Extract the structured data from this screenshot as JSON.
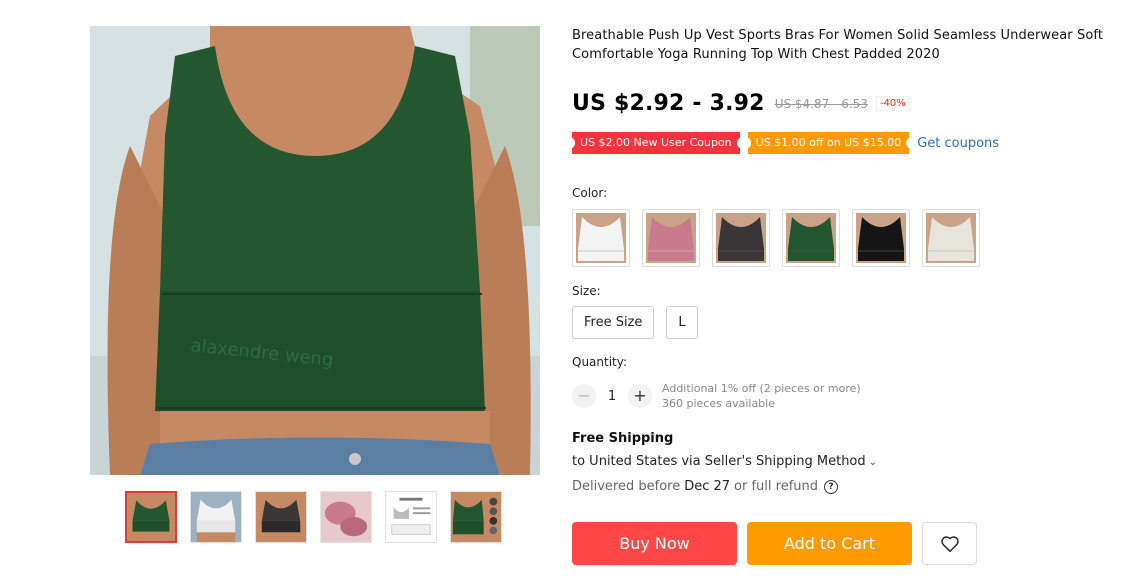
{
  "product": {
    "title": "Breathable Push Up Vest Sports Bras For Women Solid Seamless Underwear Soft Comfortable Yoga Running Top With Chest Padded 2020",
    "price": "US $2.92 - 3.92",
    "original_price": "US $4.87 - 6.53",
    "discount": "-40%",
    "main_image_text": "alaxendre weng"
  },
  "coupons": {
    "new_user": "US $2.00 New User Coupon",
    "off": "US $1.00 off on US $15.00",
    "get_label": "Get coupons"
  },
  "color": {
    "label": "Color:",
    "options": [
      {
        "name": "White",
        "hex": "#f4f4f4"
      },
      {
        "name": "Pink",
        "hex": "#c97a8c"
      },
      {
        "name": "Dark Gray",
        "hex": "#3a3637"
      },
      {
        "name": "Green",
        "hex": "#23552e"
      },
      {
        "name": "Black",
        "hex": "#151515"
      },
      {
        "name": "Beige",
        "hex": "#e7e4dc"
      }
    ]
  },
  "size": {
    "label": "Size:",
    "options": [
      "Free Size",
      "L"
    ]
  },
  "quantity": {
    "label": "Quantity:",
    "minus": "−",
    "value": "1",
    "plus": "+",
    "note1": "Additional 1% off (2 pieces or more)",
    "note2": "360 pieces available"
  },
  "shipping": {
    "title": "Free Shipping",
    "method": "to United States via Seller's Shipping Method",
    "delivery_prefix": "Delivered before",
    "delivery_date": "Dec 27",
    "delivery_suffix": "or full refund",
    "help": "?"
  },
  "actions": {
    "buy": "Buy Now",
    "cart": "Add to Cart"
  },
  "colors": {
    "accent_red": "#ff4747",
    "accent_orange": "#ff9a00",
    "link_blue": "#2e6fb5"
  }
}
